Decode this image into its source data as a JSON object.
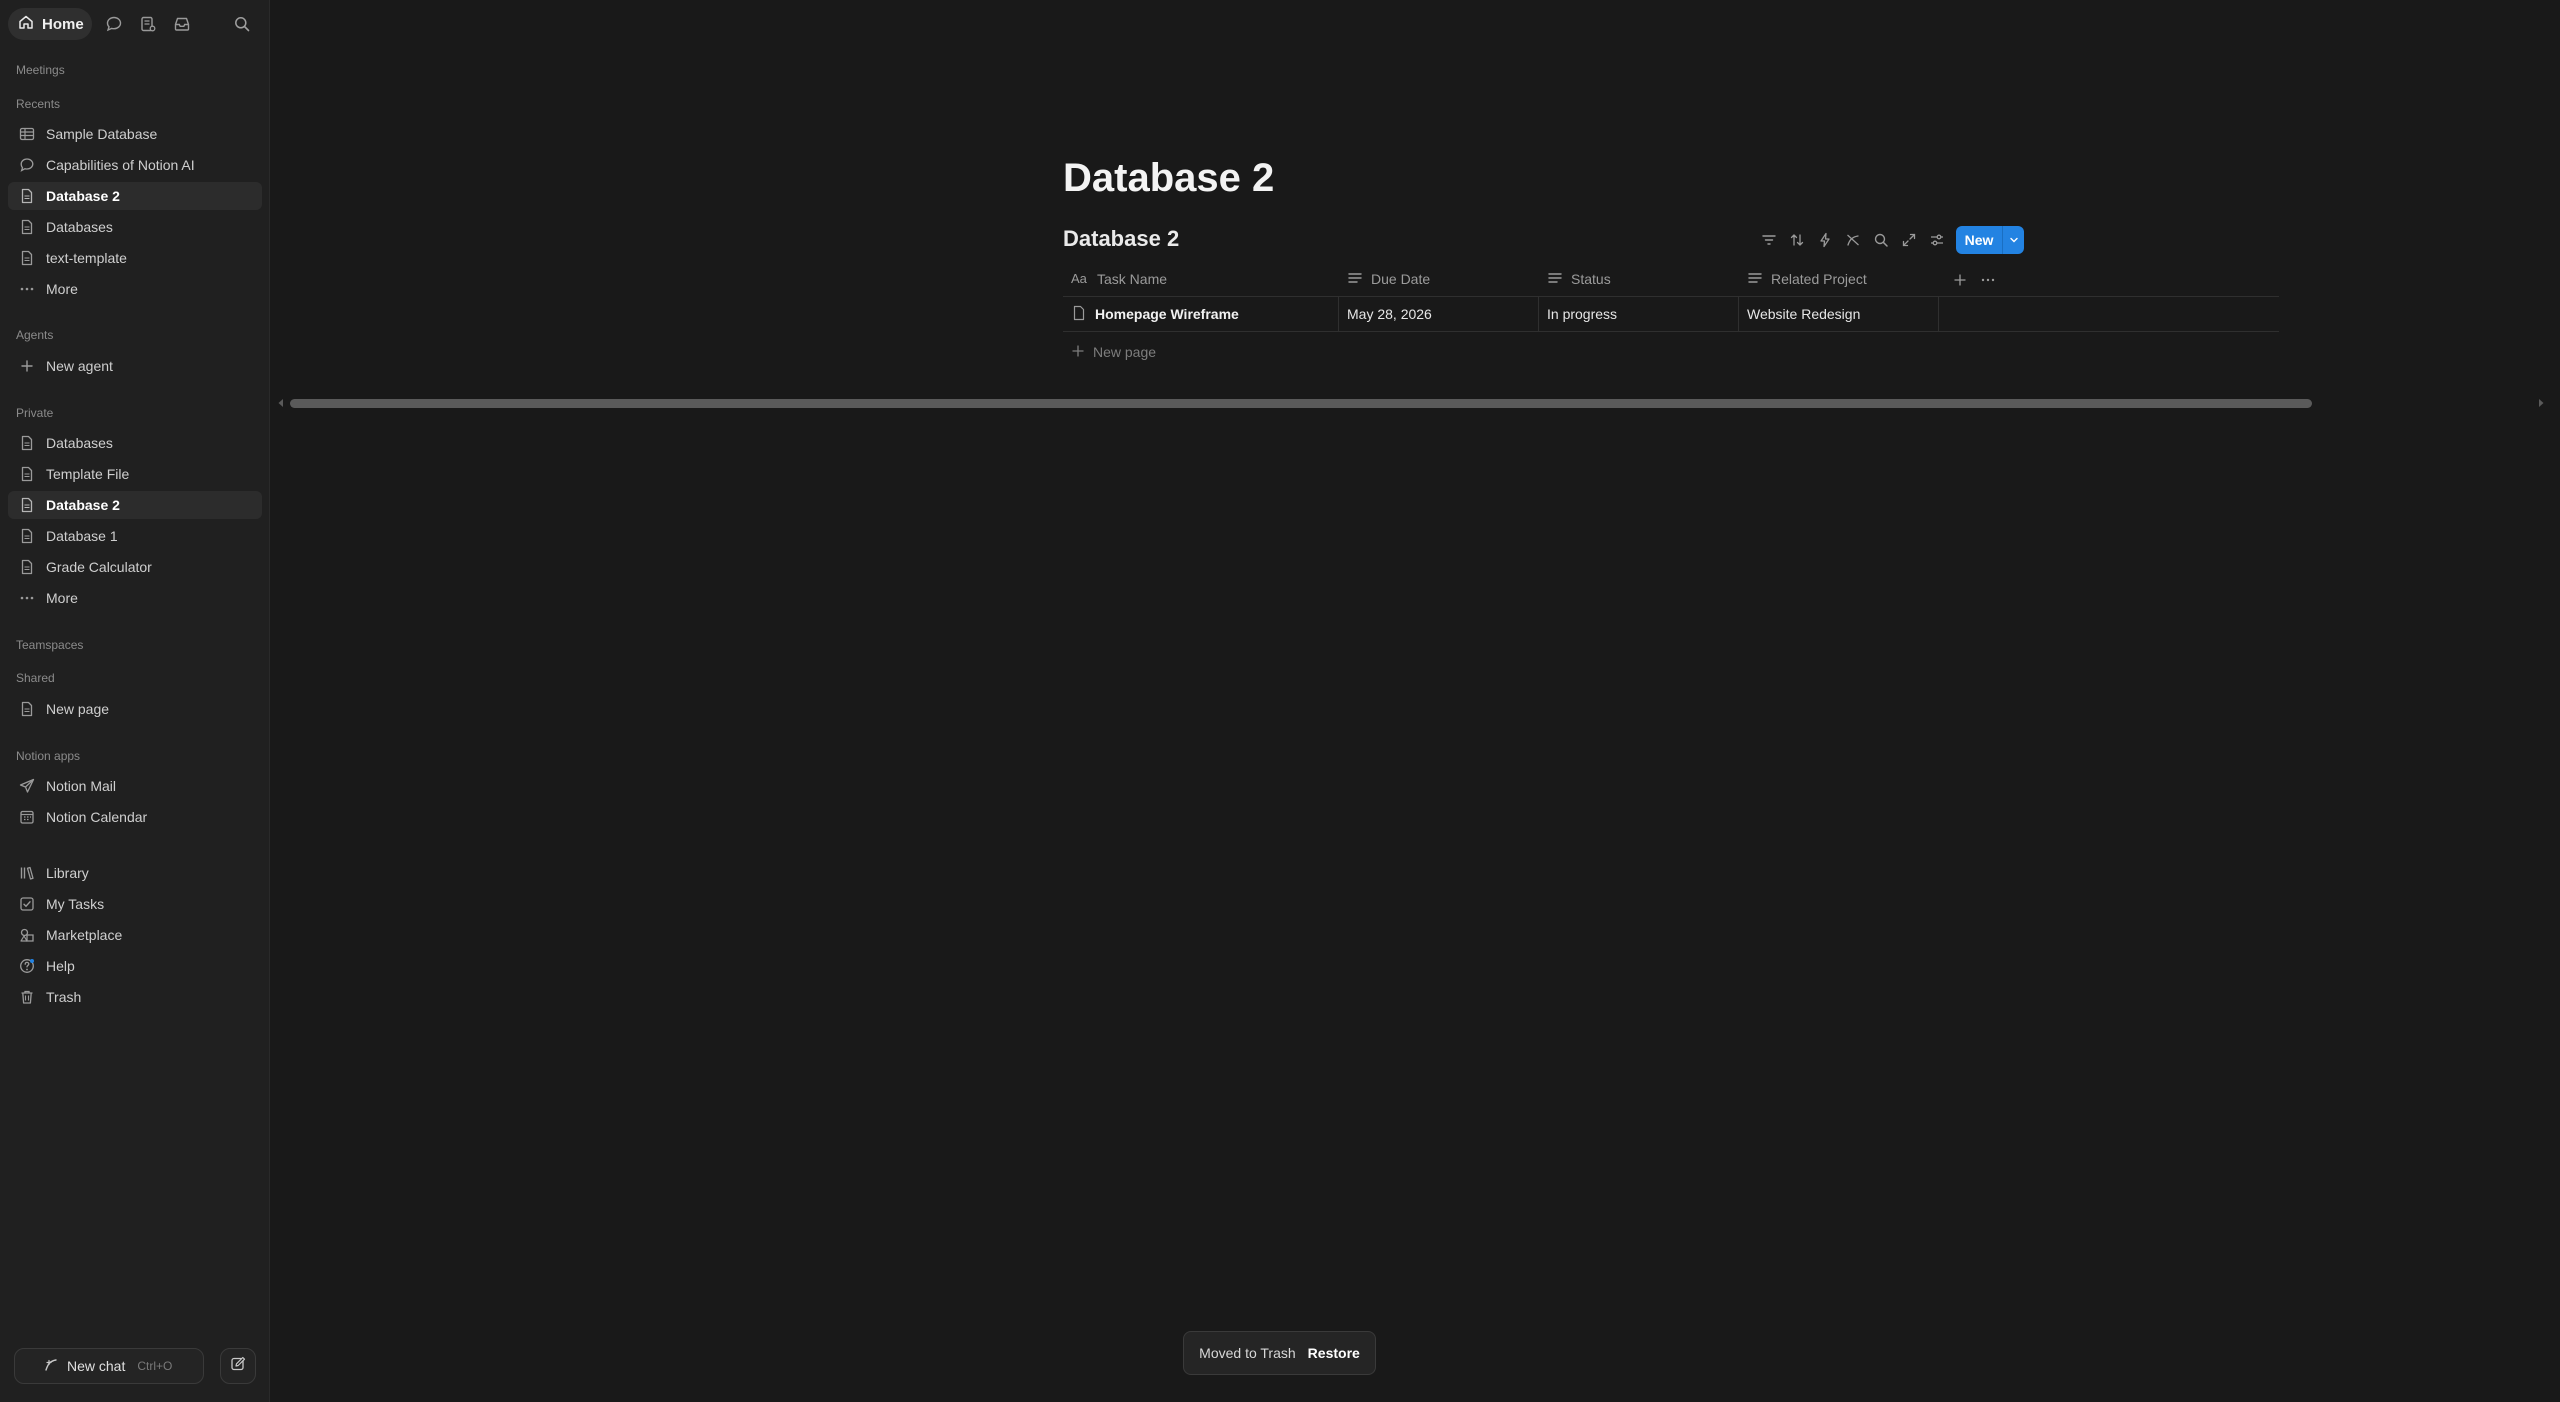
{
  "sidebar": {
    "home_label": "Home",
    "sections": {
      "meetings": "Meetings",
      "recents": "Recents",
      "agents": "Agents",
      "private": "Private",
      "teamspaces": "Teamspaces",
      "shared": "Shared",
      "notion_apps": "Notion apps"
    },
    "recents": [
      {
        "label": "Sample Database",
        "icon": "table-icon"
      },
      {
        "label": "Capabilities of Notion AI",
        "icon": "chat-bubble-icon"
      },
      {
        "label": "Database 2",
        "icon": "page-icon",
        "active": true
      },
      {
        "label": "Databases",
        "icon": "page-icon"
      },
      {
        "label": "text-template",
        "icon": "page-icon"
      },
      {
        "label": "More",
        "icon": "more-dots-icon"
      }
    ],
    "agents": [
      {
        "label": "New agent",
        "icon": "plus-icon"
      }
    ],
    "private": [
      {
        "label": "Databases",
        "icon": "page-icon"
      },
      {
        "label": "Template File",
        "icon": "page-icon"
      },
      {
        "label": "Database 2",
        "icon": "page-icon",
        "active": true
      },
      {
        "label": "Database 1",
        "icon": "page-icon"
      },
      {
        "label": "Grade Calculator",
        "icon": "page-icon"
      },
      {
        "label": "More",
        "icon": "more-dots-icon"
      }
    ],
    "shared": [
      {
        "label": "New page",
        "icon": "page-icon"
      }
    ],
    "notion_apps": [
      {
        "label": "Notion Mail",
        "icon": "mail-send-icon"
      },
      {
        "label": "Notion Calendar",
        "icon": "calendar-icon"
      }
    ],
    "bottom": [
      {
        "label": "Library",
        "icon": "library-icon"
      },
      {
        "label": "My Tasks",
        "icon": "checkbox-icon"
      },
      {
        "label": "Marketplace",
        "icon": "marketplace-icon"
      },
      {
        "label": "Help",
        "icon": "help-icon"
      },
      {
        "label": "Trash",
        "icon": "trash-icon"
      }
    ],
    "footer": {
      "new_chat_label": "New chat",
      "new_chat_shortcut": "Ctrl+O"
    }
  },
  "main": {
    "page_title": "Database 2",
    "database_title": "Database 2",
    "new_button_label": "New",
    "columns": [
      {
        "label": "Task Name",
        "icon": "title-aa-icon"
      },
      {
        "label": "Due Date",
        "icon": "text-lines-icon"
      },
      {
        "label": "Status",
        "icon": "text-lines-icon"
      },
      {
        "label": "Related Project",
        "icon": "text-lines-icon"
      }
    ],
    "rows": [
      {
        "task_name": "Homepage Wireframe",
        "due_date": "May 28, 2026",
        "status": "In progress",
        "related_project": "Website Redesign"
      }
    ],
    "new_page_label": "New page"
  },
  "toast": {
    "message": "Moved to Trash",
    "action": "Restore"
  },
  "colors": {
    "background": "#191919",
    "sidebar": "#202020",
    "accent": "#2383e2"
  }
}
